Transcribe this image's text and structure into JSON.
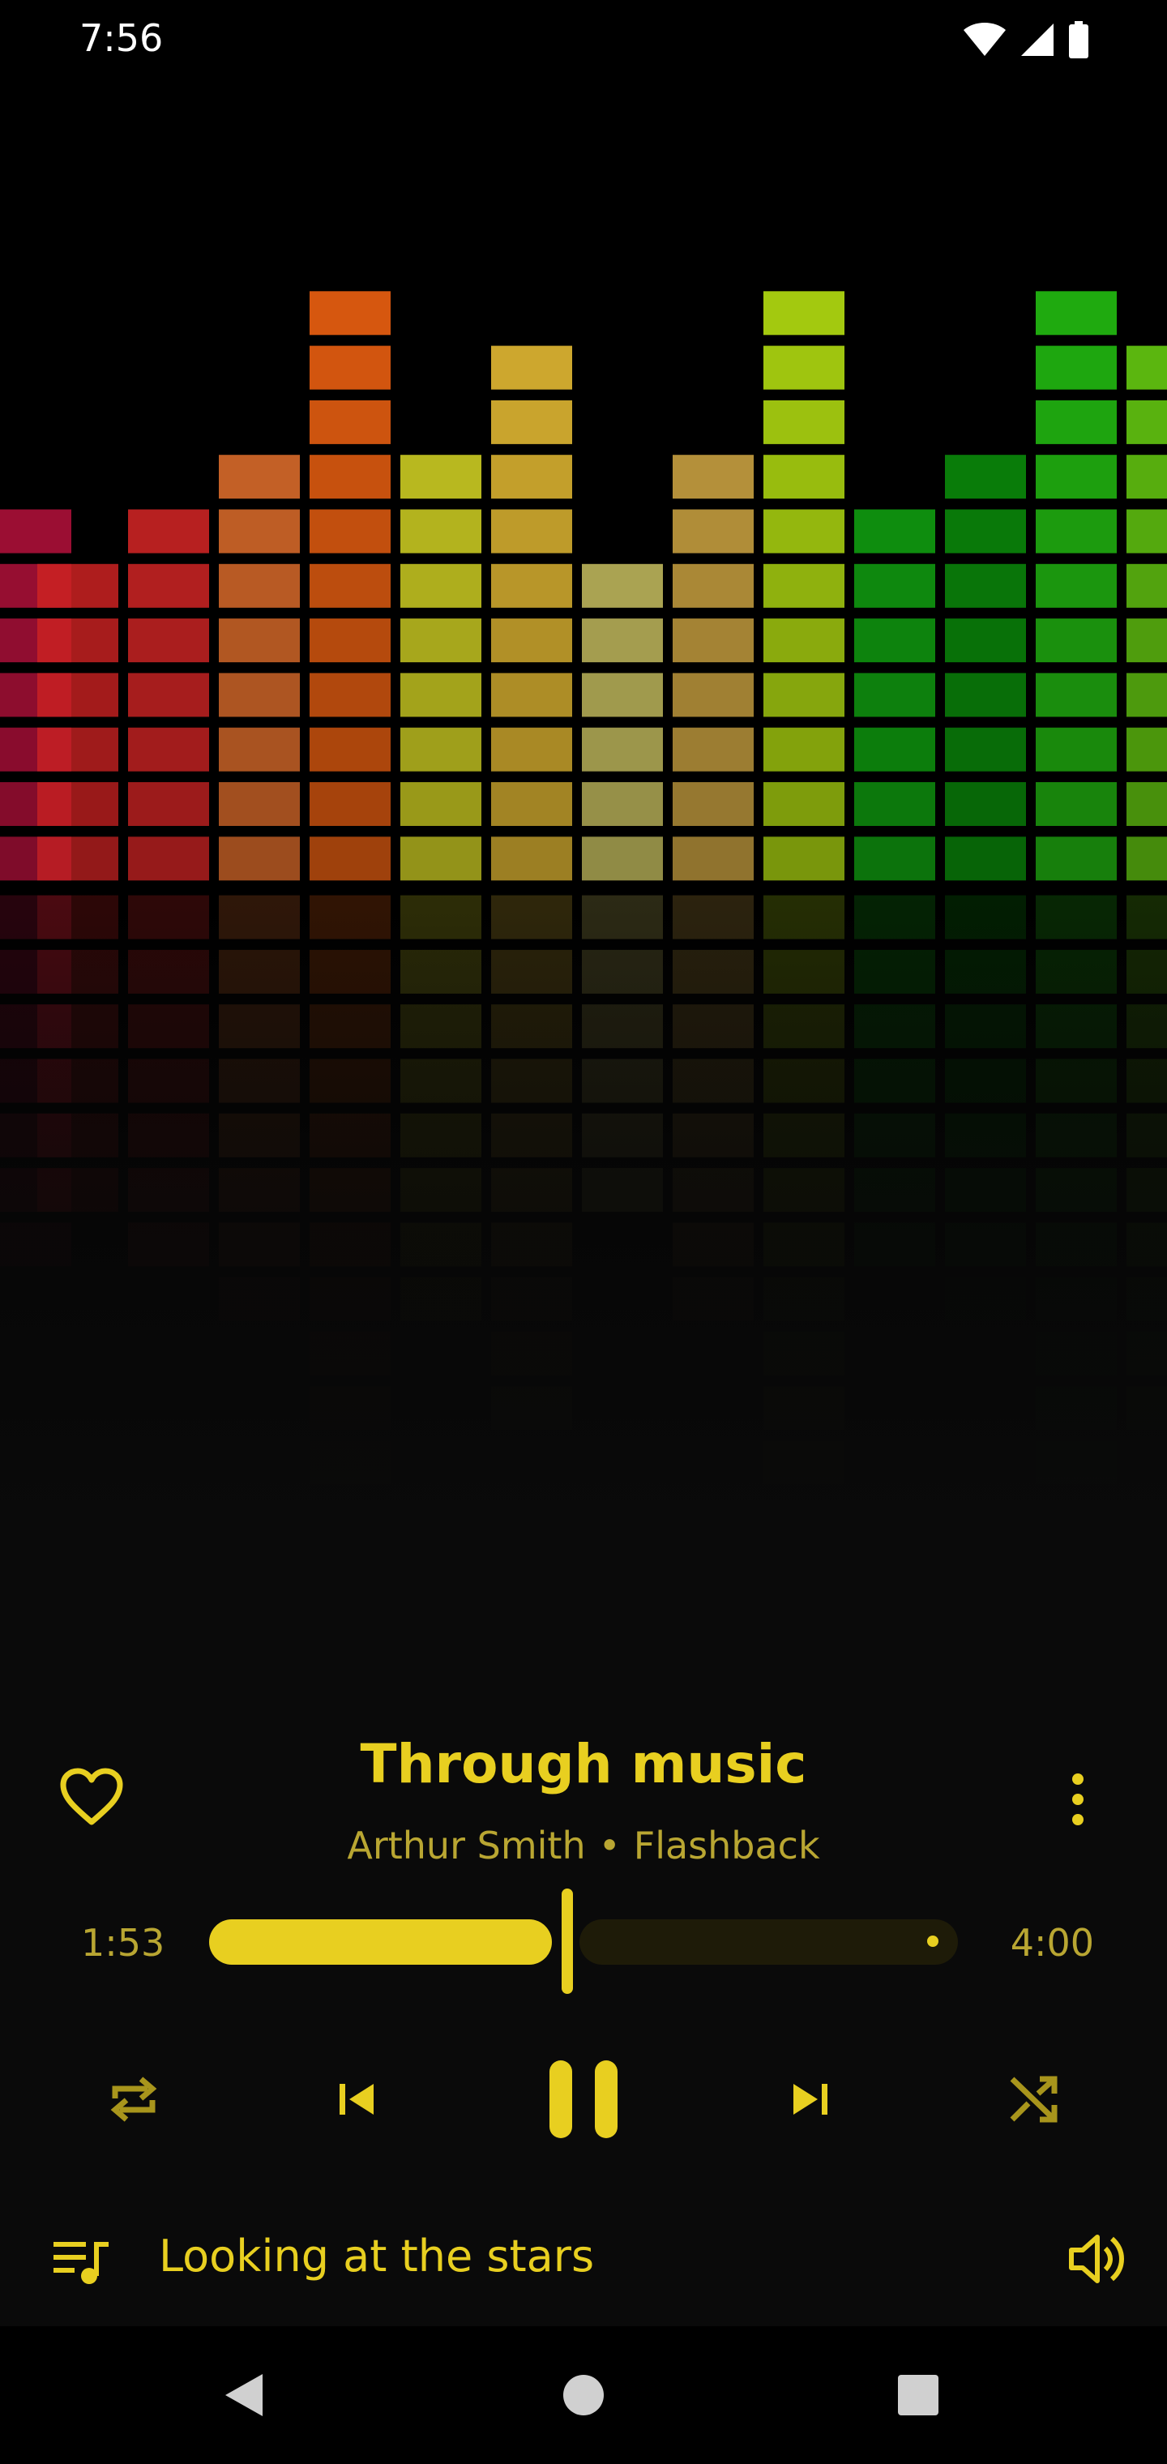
{
  "status_bar": {
    "time": "7:56",
    "icons": [
      "wifi-icon",
      "signal-icon",
      "battery-icon"
    ]
  },
  "album_art": {
    "description_icon": "equalizer-bars-art"
  },
  "now_playing": {
    "title": "Through music",
    "artist": "Arthur Smith",
    "separator": "•",
    "album": "Flashback",
    "favorite_icon": "heart-outline-icon",
    "more_icon": "more-vert-icon"
  },
  "progress": {
    "elapsed": "1:53",
    "duration": "4:00",
    "fraction": 0.4708
  },
  "transport": {
    "repeat_icon": "repeat-icon",
    "previous_icon": "skip-previous-icon",
    "play_pause_icon": "pause-icon",
    "next_icon": "skip-next-icon",
    "shuffle_icon": "shuffle-icon"
  },
  "queue_bar": {
    "queue_icon": "queue-music-icon",
    "next_track": "Looking at the stars",
    "volume_icon": "volume-up-icon"
  },
  "nav_bar": {
    "buttons": [
      "back-icon",
      "home-icon",
      "recents-icon"
    ]
  },
  "colors": {
    "accent": "#e8cf20",
    "background": "#0a0a0a"
  }
}
